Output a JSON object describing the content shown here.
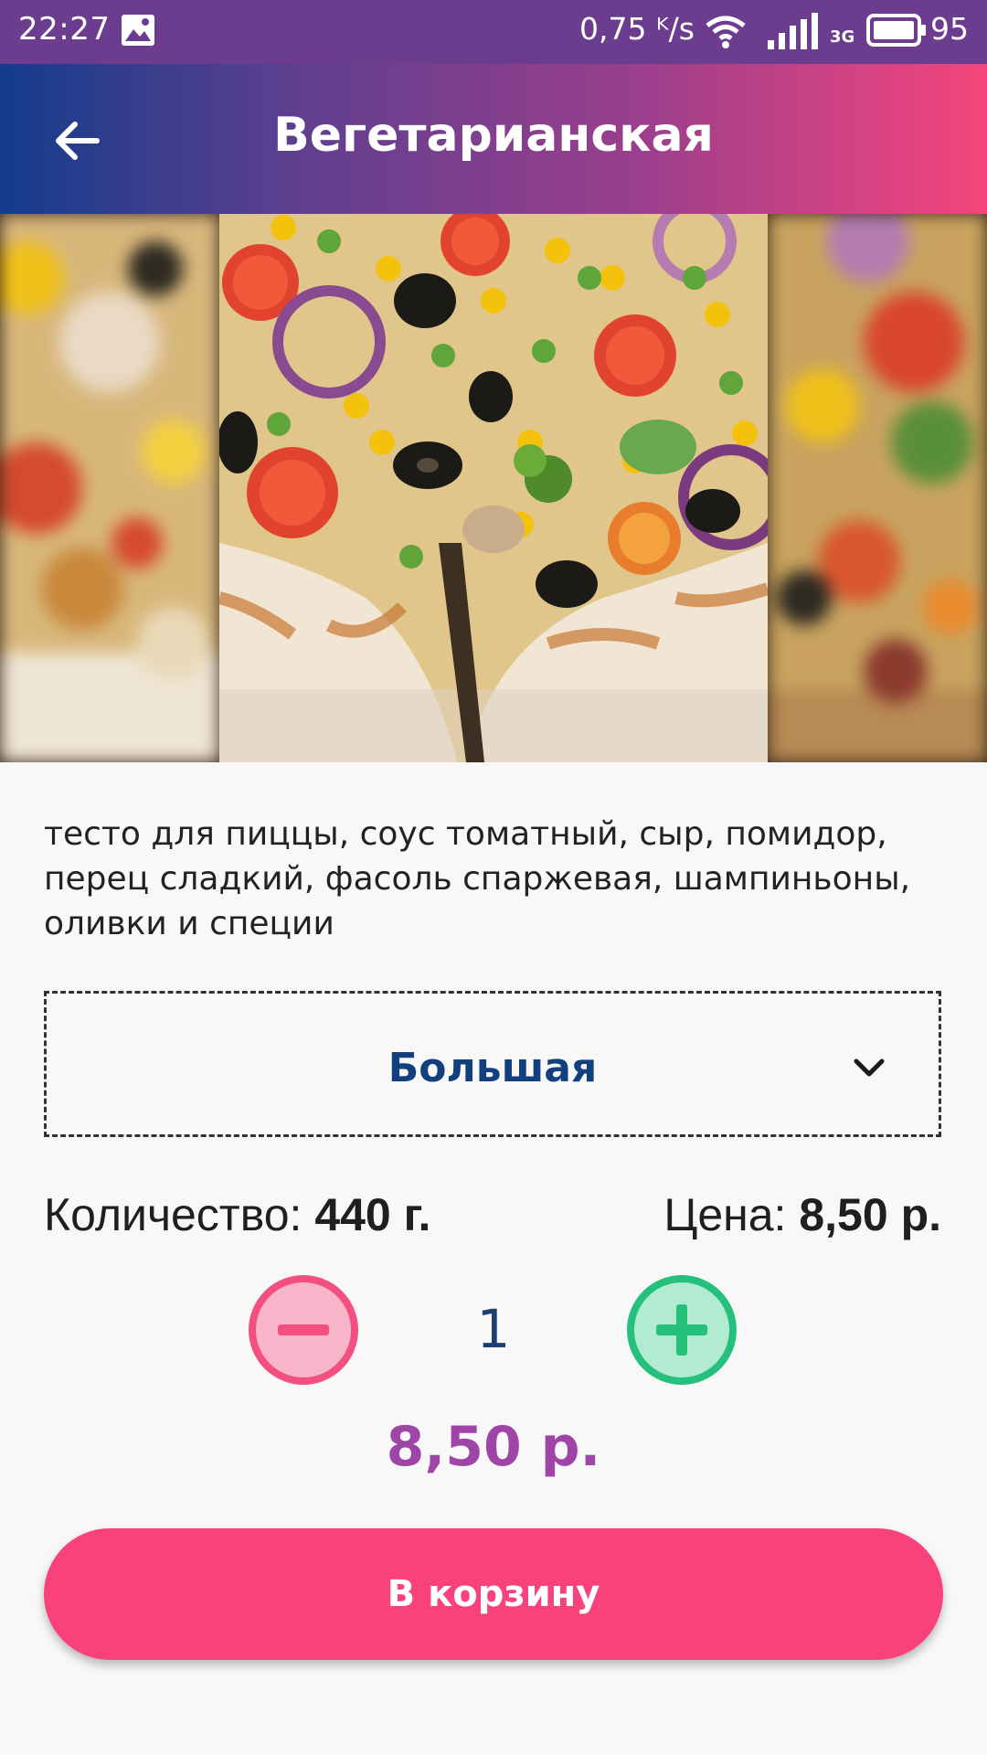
{
  "status_bar": {
    "time": "22:27",
    "network_speed": "0,75 ᴷ/s",
    "network_type": "3G",
    "battery_level": "95",
    "icons": [
      "gallery-icon",
      "wifi-icon",
      "signal-icon",
      "battery-icon"
    ]
  },
  "toolbar": {
    "title": "Вегетарианская",
    "back_icon": "arrow-left-icon"
  },
  "product": {
    "description": "тесто для пиццы, соус томатный, сыр, помидор, перец сладкий, фасоль спаржевая, шампиньоны, оливки и специи",
    "size_selected": "Большая",
    "weight_label": "Количество:",
    "weight_value": "440 г.",
    "price_label": "Цена:",
    "price_value": "8,50 р.",
    "quantity": "1",
    "total": "8,50 р.",
    "cart_button_label": "В корзину"
  },
  "colors": {
    "accent_pink": "#f9427c",
    "accent_green": "#24c07c",
    "total_purple": "#a045a8",
    "dark_blue": "#123f7d"
  }
}
